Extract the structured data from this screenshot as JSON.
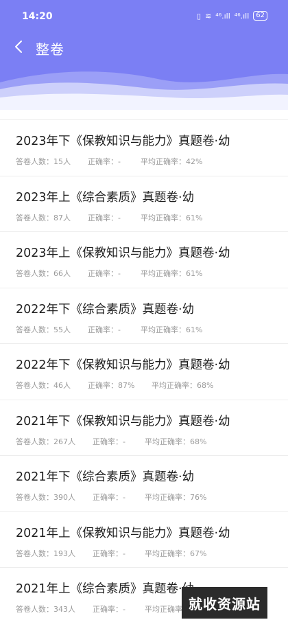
{
  "status_bar": {
    "time": "14:20",
    "signal_1": "⁴⁶.ıll",
    "signal_2": "⁴⁶.ıll",
    "battery": "62"
  },
  "nav": {
    "title": "整卷"
  },
  "labels": {
    "people": "答卷人数：",
    "accuracy": "正确率：",
    "avg_accuracy": "平均正确率："
  },
  "items": [
    {
      "title": "2023年下《保教知识与能力》真题卷·幼",
      "people": "答卷人数：15人",
      "accuracy": "正确率：-",
      "avg": "平均正确率：42%"
    },
    {
      "title": "2023年上《综合素质》真题卷·幼",
      "people": "答卷人数：87人",
      "accuracy": "正确率：-",
      "avg": "平均正确率：61%"
    },
    {
      "title": "2023年上《保教知识与能力》真题卷·幼",
      "people": "答卷人数：66人",
      "accuracy": "正确率：-",
      "avg": "平均正确率：61%"
    },
    {
      "title": "2022年下《综合素质》真题卷·幼",
      "people": "答卷人数：55人",
      "accuracy": "正确率：-",
      "avg": "平均正确率：61%"
    },
    {
      "title": "2022年下《保教知识与能力》真题卷·幼",
      "people": "答卷人数：46人",
      "accuracy": "正确率：87%",
      "avg": "平均正确率：68%"
    },
    {
      "title": "2021年下《保教知识与能力》真题卷·幼",
      "people": "答卷人数：267人",
      "accuracy": "正确率：-",
      "avg": "平均正确率：68%"
    },
    {
      "title": "2021年下《综合素质》真题卷·幼",
      "people": "答卷人数：390人",
      "accuracy": "正确率：-",
      "avg": "平均正确率：76%"
    },
    {
      "title": "2021年上《保教知识与能力》真题卷·幼",
      "people": "答卷人数：193人",
      "accuracy": "正确率：-",
      "avg": "平均正确率：67%"
    },
    {
      "title": "2021年上《综合素质》真题卷·幼",
      "people": "答卷人数：343人",
      "accuracy": "正确率：-",
      "avg": "平均正确率："
    }
  ],
  "watermark": "就收资源站",
  "colors": {
    "header": "#7b7ff4",
    "divider": "#ededed",
    "stat_text": "#9a9a9a"
  }
}
